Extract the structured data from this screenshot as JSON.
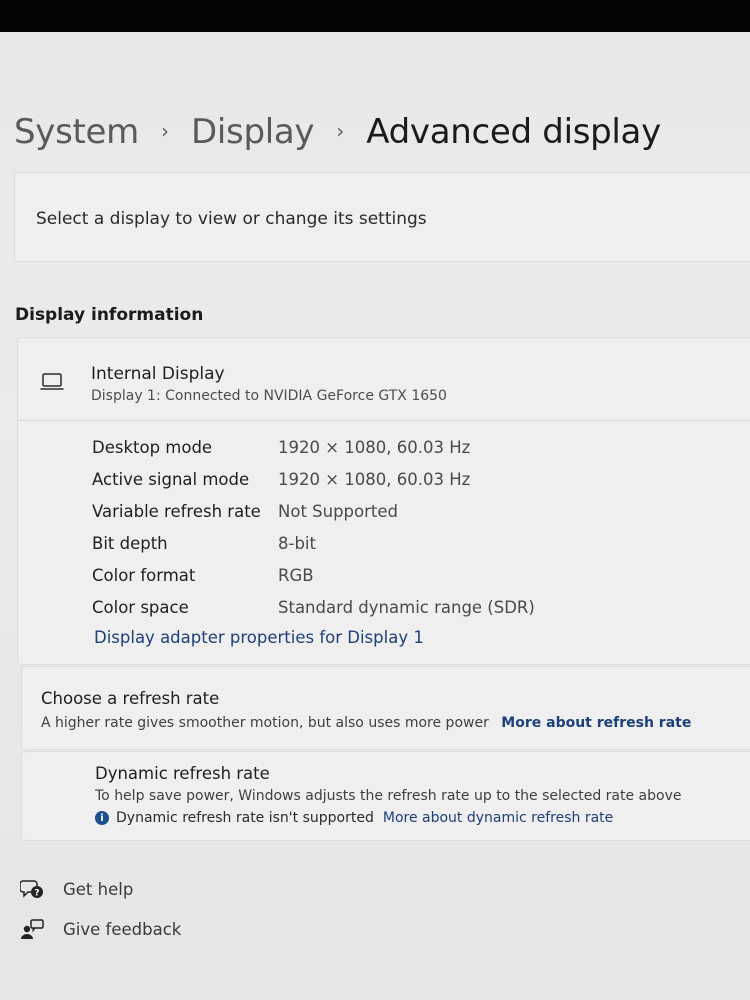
{
  "breadcrumb": {
    "items": [
      "System",
      "Display",
      "Advanced display"
    ],
    "separator": "›"
  },
  "select_display": {
    "text": "Select a display to view or change its settings"
  },
  "display_information": {
    "section_title": "Display information",
    "icon": "laptop-icon",
    "display_name": "Internal Display",
    "display_subtitle": "Display 1: Connected to NVIDIA GeForce GTX 1650",
    "properties": [
      {
        "label": "Desktop mode",
        "value": "1920 × 1080, 60.03 Hz"
      },
      {
        "label": "Active signal mode",
        "value": "1920 × 1080, 60.03 Hz"
      },
      {
        "label": "Variable refresh rate",
        "value": "Not Supported"
      },
      {
        "label": "Bit depth",
        "value": "8-bit"
      },
      {
        "label": "Color format",
        "value": "RGB"
      },
      {
        "label": "Color space",
        "value": "Standard dynamic range (SDR)"
      }
    ],
    "adapter_link": "Display adapter properties for Display 1"
  },
  "refresh_rate": {
    "title": "Choose a refresh rate",
    "subtitle": "A higher rate gives smoother motion, but also uses more power",
    "link": "More about refresh rate"
  },
  "dynamic_refresh": {
    "title": "Dynamic refresh rate",
    "subtitle": "To help save power, Windows adjusts the refresh rate up to the selected rate above",
    "note_icon": "info-icon",
    "note": "Dynamic refresh rate isn't supported",
    "link": "More about dynamic refresh rate"
  },
  "footer": {
    "get_help": "Get help",
    "give_feedback": "Give feedback"
  },
  "colors": {
    "accent_link": "#1d3f7a",
    "background": "#e9eaea",
    "card": "#efefef"
  }
}
